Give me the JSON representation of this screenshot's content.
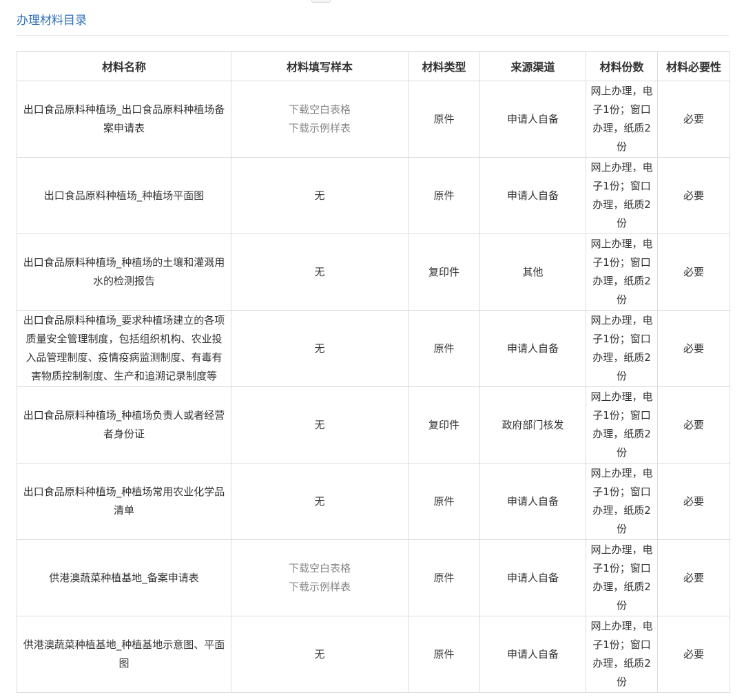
{
  "section": {
    "title": "办理材料目录"
  },
  "table": {
    "headers": [
      "材料名称",
      "材料填写样本",
      "材料类型",
      "来源渠道",
      "材料份数",
      "材料必要性"
    ],
    "rows": [
      {
        "name": "出口食品原料种植场_出口食品原料种植场备案申请表",
        "sample_links": [
          "下载空白表格",
          "下载示例样表"
        ],
        "sample_text": "",
        "type": "原件",
        "source": "申请人自备",
        "copies": "网上办理，电子1份；窗口办理，纸质2份",
        "necessity": "必要"
      },
      {
        "name": "出口食品原料种植场_种植场平面图",
        "sample_links": [],
        "sample_text": "无",
        "type": "原件",
        "source": "申请人自备",
        "copies": "网上办理，电子1份；窗口办理，纸质2份",
        "necessity": "必要"
      },
      {
        "name": "出口食品原料种植场_种植场的土壤和灌溉用水的检测报告",
        "sample_links": [],
        "sample_text": "无",
        "type": "复印件",
        "source": "其他",
        "copies": "网上办理，电子1份；窗口办理，纸质2份",
        "necessity": "必要"
      },
      {
        "name": "出口食品原料种植场_要求种植场建立的各项质量安全管理制度，包括组织机构、农业投入品管理制度、疫情疫病监测制度、有毒有害物质控制制度、生产和追溯记录制度等",
        "sample_links": [],
        "sample_text": "无",
        "type": "原件",
        "source": "申请人自备",
        "copies": "网上办理，电子1份；窗口办理，纸质2份",
        "necessity": "必要"
      },
      {
        "name": "出口食品原料种植场_种植场负责人或者经营者身份证",
        "sample_links": [],
        "sample_text": "无",
        "type": "复印件",
        "source": "政府部门核发",
        "copies": "网上办理，电子1份；窗口办理，纸质2份",
        "necessity": "必要"
      },
      {
        "name": "出口食品原料种植场_种植场常用农业化学品清单",
        "sample_links": [],
        "sample_text": "无",
        "type": "原件",
        "source": "申请人自备",
        "copies": "网上办理，电子1份；窗口办理，纸质2份",
        "necessity": "必要"
      },
      {
        "name": "供港澳蔬菜种植基地_备案申请表",
        "sample_links": [
          "下载空白表格",
          "下载示例样表"
        ],
        "sample_text": "",
        "type": "原件",
        "source": "申请人自备",
        "copies": "网上办理，电子1份；窗口办理，纸质2份",
        "necessity": "必要"
      },
      {
        "name": "供港澳蔬菜种植基地_种植基地示意图、平面图",
        "sample_links": [],
        "sample_text": "无",
        "type": "原件",
        "source": "申请人自备",
        "copies": "网上办理，电子1份；窗口办理，纸质2份",
        "necessity": "必要"
      }
    ]
  }
}
